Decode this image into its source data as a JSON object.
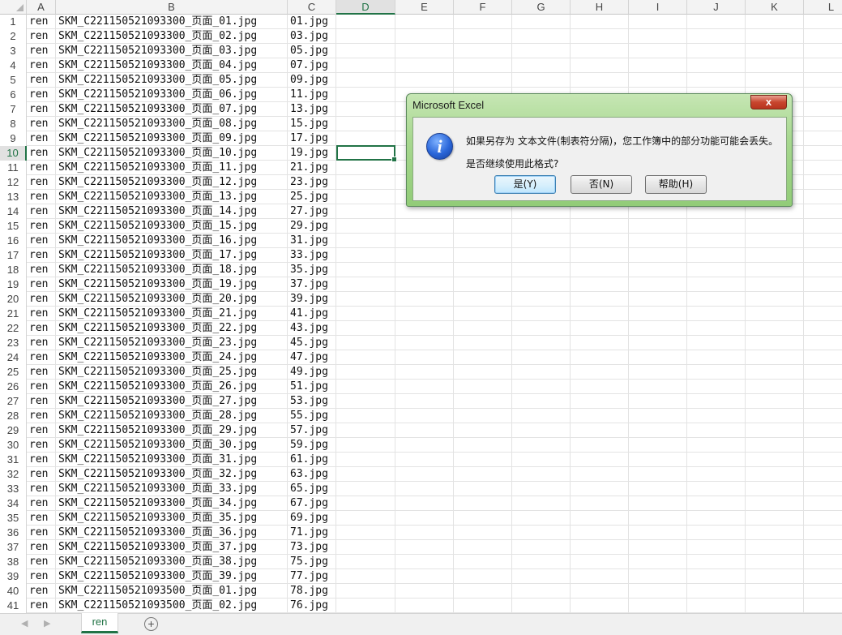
{
  "columns": [
    "A",
    "B",
    "C",
    "D",
    "E",
    "F",
    "G",
    "H",
    "I",
    "J",
    "K",
    "L"
  ],
  "active_column": "D",
  "active_row": 10,
  "rows": [
    {
      "n": "1",
      "a": "ren",
      "b": "SKM_C221150521093300_页面_01.jpg",
      "c": "01.jpg"
    },
    {
      "n": "2",
      "a": "ren",
      "b": "SKM_C221150521093300_页面_02.jpg",
      "c": "03.jpg"
    },
    {
      "n": "3",
      "a": "ren",
      "b": "SKM_C221150521093300_页面_03.jpg",
      "c": "05.jpg"
    },
    {
      "n": "4",
      "a": "ren",
      "b": "SKM_C221150521093300_页面_04.jpg",
      "c": "07.jpg"
    },
    {
      "n": "5",
      "a": "ren",
      "b": "SKM_C221150521093300_页面_05.jpg",
      "c": "09.jpg"
    },
    {
      "n": "6",
      "a": "ren",
      "b": "SKM_C221150521093300_页面_06.jpg",
      "c": "11.jpg"
    },
    {
      "n": "7",
      "a": "ren",
      "b": "SKM_C221150521093300_页面_07.jpg",
      "c": "13.jpg"
    },
    {
      "n": "8",
      "a": "ren",
      "b": "SKM_C221150521093300_页面_08.jpg",
      "c": "15.jpg"
    },
    {
      "n": "9",
      "a": "ren",
      "b": "SKM_C221150521093300_页面_09.jpg",
      "c": "17.jpg"
    },
    {
      "n": "10",
      "a": "ren",
      "b": "SKM_C221150521093300_页面_10.jpg",
      "c": "19.jpg"
    },
    {
      "n": "11",
      "a": "ren",
      "b": "SKM_C221150521093300_页面_11.jpg",
      "c": "21.jpg"
    },
    {
      "n": "12",
      "a": "ren",
      "b": "SKM_C221150521093300_页面_12.jpg",
      "c": "23.jpg"
    },
    {
      "n": "13",
      "a": "ren",
      "b": "SKM_C221150521093300_页面_13.jpg",
      "c": "25.jpg"
    },
    {
      "n": "14",
      "a": "ren",
      "b": "SKM_C221150521093300_页面_14.jpg",
      "c": "27.jpg"
    },
    {
      "n": "15",
      "a": "ren",
      "b": "SKM_C221150521093300_页面_15.jpg",
      "c": "29.jpg"
    },
    {
      "n": "16",
      "a": "ren",
      "b": "SKM_C221150521093300_页面_16.jpg",
      "c": "31.jpg"
    },
    {
      "n": "17",
      "a": "ren",
      "b": "SKM_C221150521093300_页面_17.jpg",
      "c": "33.jpg"
    },
    {
      "n": "18",
      "a": "ren",
      "b": "SKM_C221150521093300_页面_18.jpg",
      "c": "35.jpg"
    },
    {
      "n": "19",
      "a": "ren",
      "b": "SKM_C221150521093300_页面_19.jpg",
      "c": "37.jpg"
    },
    {
      "n": "20",
      "a": "ren",
      "b": "SKM_C221150521093300_页面_20.jpg",
      "c": "39.jpg"
    },
    {
      "n": "21",
      "a": "ren",
      "b": "SKM_C221150521093300_页面_21.jpg",
      "c": "41.jpg"
    },
    {
      "n": "22",
      "a": "ren",
      "b": "SKM_C221150521093300_页面_22.jpg",
      "c": "43.jpg"
    },
    {
      "n": "23",
      "a": "ren",
      "b": "SKM_C221150521093300_页面_23.jpg",
      "c": "45.jpg"
    },
    {
      "n": "24",
      "a": "ren",
      "b": "SKM_C221150521093300_页面_24.jpg",
      "c": "47.jpg"
    },
    {
      "n": "25",
      "a": "ren",
      "b": "SKM_C221150521093300_页面_25.jpg",
      "c": "49.jpg"
    },
    {
      "n": "26",
      "a": "ren",
      "b": "SKM_C221150521093300_页面_26.jpg",
      "c": "51.jpg"
    },
    {
      "n": "27",
      "a": "ren",
      "b": "SKM_C221150521093300_页面_27.jpg",
      "c": "53.jpg"
    },
    {
      "n": "28",
      "a": "ren",
      "b": "SKM_C221150521093300_页面_28.jpg",
      "c": "55.jpg"
    },
    {
      "n": "29",
      "a": "ren",
      "b": "SKM_C221150521093300_页面_29.jpg",
      "c": "57.jpg"
    },
    {
      "n": "30",
      "a": "ren",
      "b": "SKM_C221150521093300_页面_30.jpg",
      "c": "59.jpg"
    },
    {
      "n": "31",
      "a": "ren",
      "b": "SKM_C221150521093300_页面_31.jpg",
      "c": "61.jpg"
    },
    {
      "n": "32",
      "a": "ren",
      "b": "SKM_C221150521093300_页面_32.jpg",
      "c": "63.jpg"
    },
    {
      "n": "33",
      "a": "ren",
      "b": "SKM_C221150521093300_页面_33.jpg",
      "c": "65.jpg"
    },
    {
      "n": "34",
      "a": "ren",
      "b": "SKM_C221150521093300_页面_34.jpg",
      "c": "67.jpg"
    },
    {
      "n": "35",
      "a": "ren",
      "b": "SKM_C221150521093300_页面_35.jpg",
      "c": "69.jpg"
    },
    {
      "n": "36",
      "a": "ren",
      "b": "SKM_C221150521093300_页面_36.jpg",
      "c": "71.jpg"
    },
    {
      "n": "37",
      "a": "ren",
      "b": "SKM_C221150521093300_页面_37.jpg",
      "c": "73.jpg"
    },
    {
      "n": "38",
      "a": "ren",
      "b": "SKM_C221150521093300_页面_38.jpg",
      "c": "75.jpg"
    },
    {
      "n": "39",
      "a": "ren",
      "b": "SKM_C221150521093300_页面_39.jpg",
      "c": "77.jpg"
    },
    {
      "n": "40",
      "a": "ren",
      "b": "SKM_C221150521093500_页面_01.jpg",
      "c": "78.jpg"
    },
    {
      "n": "41",
      "a": "ren",
      "b": "SKM_C221150521093500_页面_02.jpg",
      "c": "76.jpg"
    }
  ],
  "sheet_tab": "ren",
  "add_sheet_symbol": "+",
  "nav_arrows": {
    "prev": "◀",
    "next": "▶"
  },
  "dialog": {
    "title": "Microsoft Excel",
    "close": "x",
    "icon_glyph": "i",
    "message_line1": "如果另存为 文本文件(制表符分隔)，您工作簿中的部分功能可能会丢失。",
    "message_line2": "是否继续使用此格式?",
    "yes": "是(Y)",
    "no": "否(N)",
    "help": "帮助(H)"
  },
  "colors": {
    "accent": "#217346"
  }
}
